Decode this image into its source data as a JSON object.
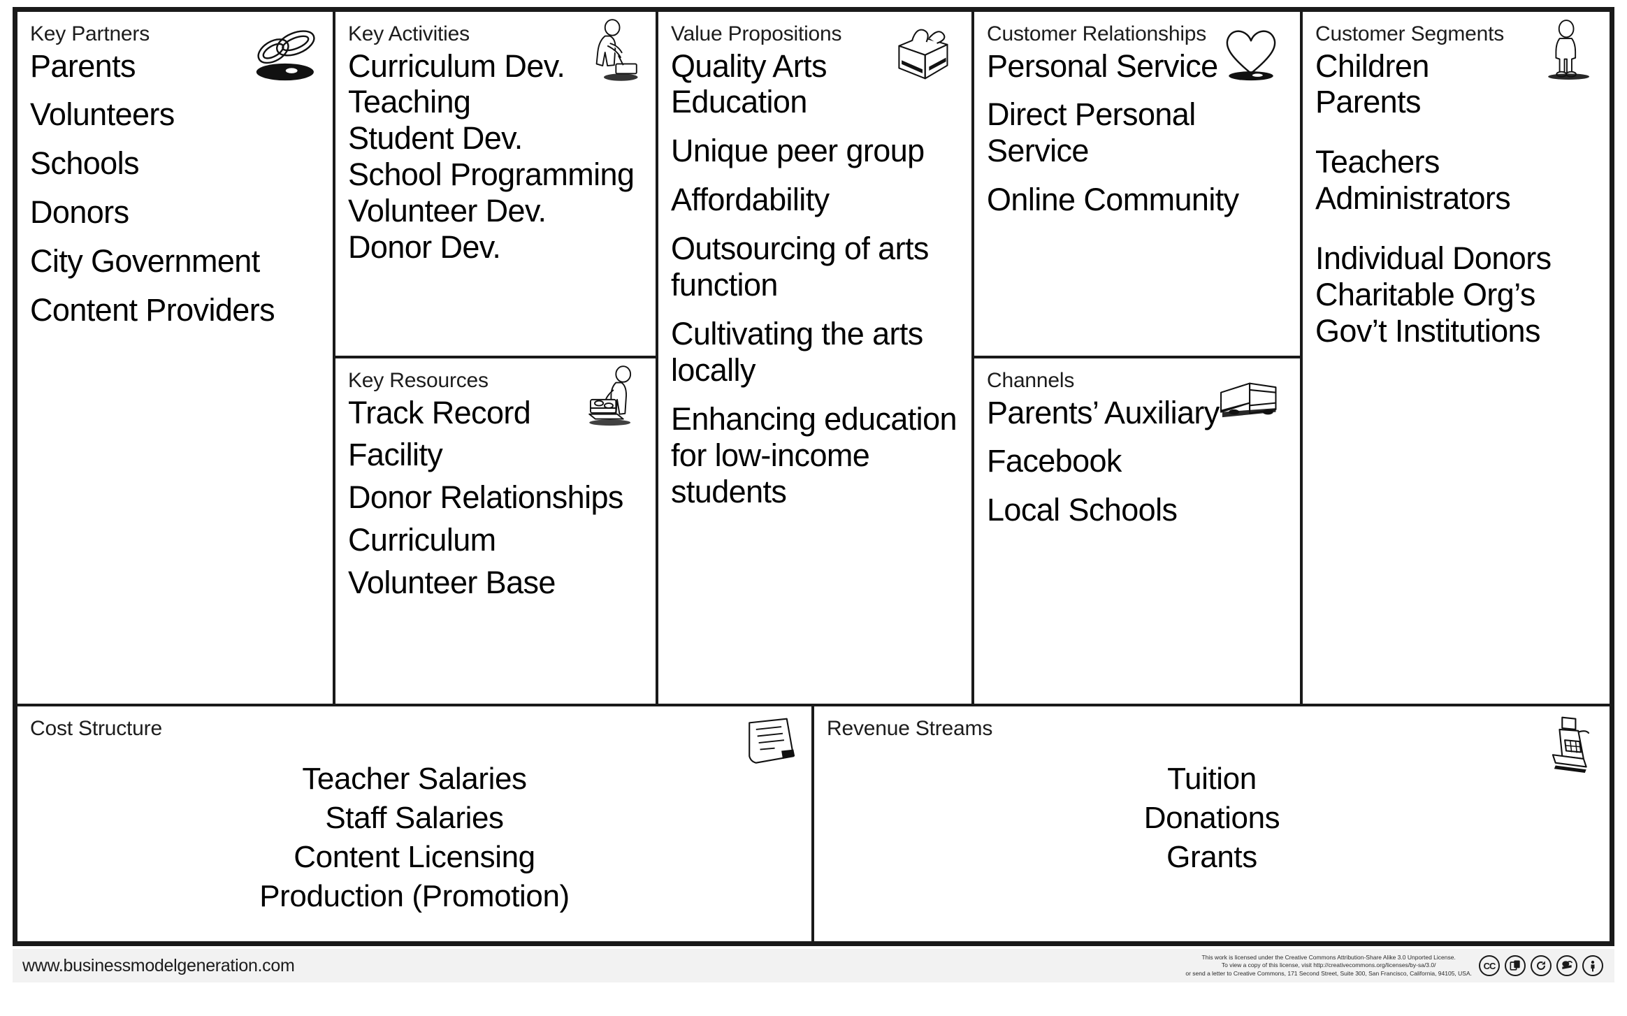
{
  "canvas": {
    "blocks": {
      "key_partners": {
        "title": "Key Partners",
        "icon": "chain-links-icon",
        "items": [
          "Parents",
          "Volunteers",
          "Schools",
          "Donors",
          "City Government",
          "Content Providers"
        ]
      },
      "key_activities": {
        "title": "Key Activities",
        "icon": "person-hammer-icon",
        "items": [
          "Curriculum Dev.",
          "Teaching",
          "Student Dev.",
          "School Programming",
          "Volunteer Dev.",
          "Donor Dev."
        ]
      },
      "key_resources": {
        "title": "Key Resources",
        "icon": "person-pallet-icon",
        "items": [
          "Track Record",
          "Facility",
          "Donor Relationships",
          "Curriculum",
          "Volunteer Base"
        ]
      },
      "value_propositions": {
        "title": "Value Propositions",
        "icon": "gift-package-icon",
        "items": [
          "Quality Arts Education",
          "Unique peer group",
          "Affordability",
          "Outsourcing of arts function",
          "Cultivating the arts locally",
          "Enhancing education for low-income students"
        ]
      },
      "customer_relationships": {
        "title": "Customer Relationships",
        "icon": "heart-icon",
        "items": [
          "Personal Service",
          "Direct Personal Service",
          "Online Community"
        ]
      },
      "channels": {
        "title": "Channels",
        "icon": "delivery-truck-icon",
        "items": [
          "Parents’ Auxiliary",
          "Facebook",
          "Local Schools"
        ]
      },
      "customer_segments": {
        "title": "Customer Segments",
        "icon": "standing-person-icon",
        "group_1": [
          "Children",
          "Parents"
        ],
        "group_2": [
          "Teachers",
          "Administrators"
        ],
        "group_3": [
          "Individual Donors",
          "Charitable Org’s",
          "Gov’t Institutions"
        ]
      },
      "cost_structure": {
        "title": "Cost Structure",
        "icon": "receipt-icon",
        "items": [
          "Teacher Salaries",
          "Staff Salaries",
          "Content Licensing",
          "Production (Promotion)"
        ]
      },
      "revenue_streams": {
        "title": "Revenue Streams",
        "icon": "cash-register-icon",
        "items": [
          "Tuition",
          "Donations",
          "Grants"
        ]
      }
    }
  },
  "footer": {
    "url": "www.businessmodelgeneration.com",
    "license_line_1": "This work is licensed under the Creative Commons Attribution-Share Alike 3.0 Unported License.",
    "license_line_2": "To view a copy of this license, visit http://creativecommons.org/licenses/by-sa/3.0/",
    "license_line_3": "or send a letter to Creative Commons, 171 Second Street, Suite 300, San Francisco, California, 94105, USA.",
    "badges": [
      "cc-icon",
      "share-copy-icon",
      "share-alike-icon",
      "remix-icon",
      "attribution-person-icon"
    ]
  },
  "colors": {
    "ink": "#1a1a1a",
    "footer_background": "#f2f2f2",
    "page_background": "#ffffff"
  }
}
